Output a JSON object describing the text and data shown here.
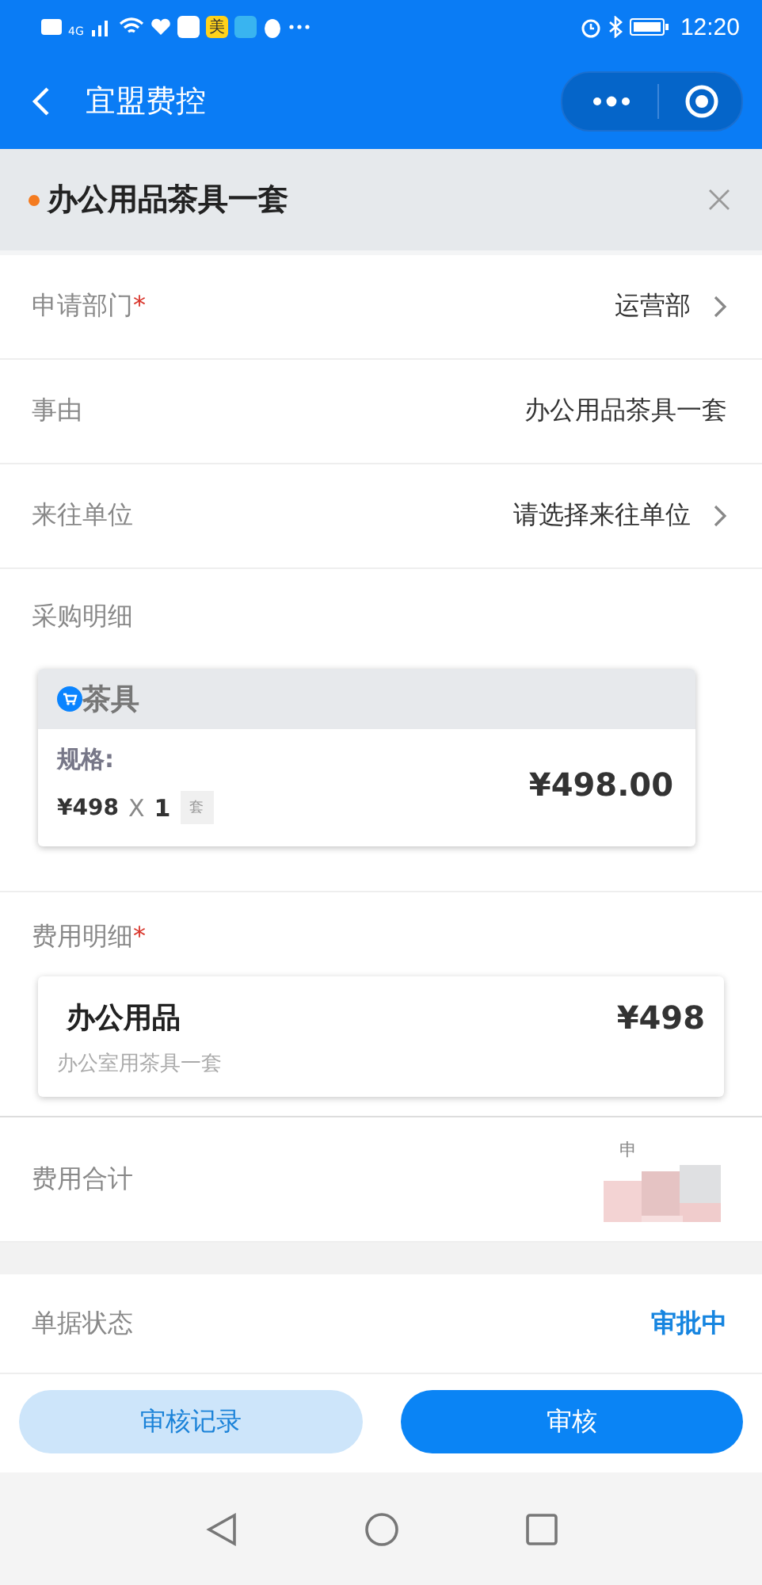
{
  "status_bar": {
    "network": "4G",
    "app_badge": "美",
    "time": "12:20"
  },
  "nav": {
    "title": "宜盟费控"
  },
  "header": {
    "title": "办公用品茶具一套"
  },
  "fields": [
    {
      "label": "申请部门",
      "required_mark": "*",
      "value": "运营部",
      "kind": "select"
    },
    {
      "label": "事由",
      "value": "办公用品茶具一套",
      "kind": "text"
    },
    {
      "label": "来往单位",
      "value": "请选择来往单位",
      "kind": "select"
    }
  ],
  "purchase": {
    "label": "采购明细",
    "items": [
      {
        "name": "茶具",
        "spec_label": "规格:",
        "unit_price": "¥498",
        "multiply": "X",
        "quantity": "1",
        "unit": "套",
        "total": "¥498.00"
      }
    ]
  },
  "expenses": {
    "label": "费用明细",
    "required_mark": "*",
    "items": [
      {
        "name": "办公用品",
        "note": "办公室用茶具一套",
        "amount": "¥498"
      }
    ]
  },
  "total": {
    "label": "费用合计",
    "caption": "申"
  },
  "status": {
    "label": "单据状态",
    "value": "审批中"
  },
  "buttons": [
    {
      "label": "审核记录",
      "kind": "secondary"
    },
    {
      "label": "审核",
      "kind": "primary"
    }
  ]
}
